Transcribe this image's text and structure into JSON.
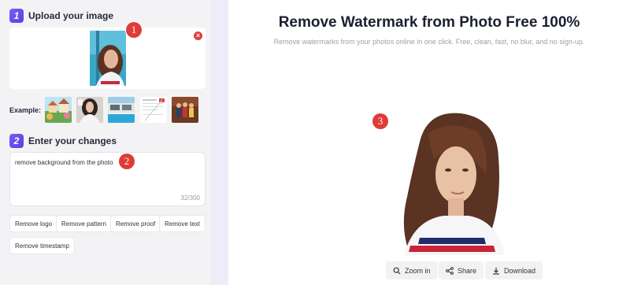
{
  "steps": [
    {
      "number": "1",
      "title": "Upload your image"
    },
    {
      "number": "2",
      "title": "Enter your changes"
    }
  ],
  "upload": {
    "close_icon": "×"
  },
  "badges": {
    "one": "1",
    "two": "2",
    "three": "3"
  },
  "examples": {
    "label": "Example:"
  },
  "prompt": {
    "value": "remove background from the photo",
    "counter": "32/300"
  },
  "chips": [
    "Remove logo",
    "Remove pattern",
    "Remove proof",
    "Remove text",
    "Remove timestamp"
  ],
  "header": {
    "title": "Remove Watermark from Photo Free 100%",
    "subtitle": "Remove watermarks from your photos online in one click. Free, clean, fast, no blur, and no sign-up."
  },
  "actions": {
    "zoom": "Zoom in",
    "share": "Share",
    "download": "Download"
  },
  "colors": {
    "accent": "#6b4ef0",
    "badge": "#e03b36",
    "close": "#e23c3c"
  }
}
